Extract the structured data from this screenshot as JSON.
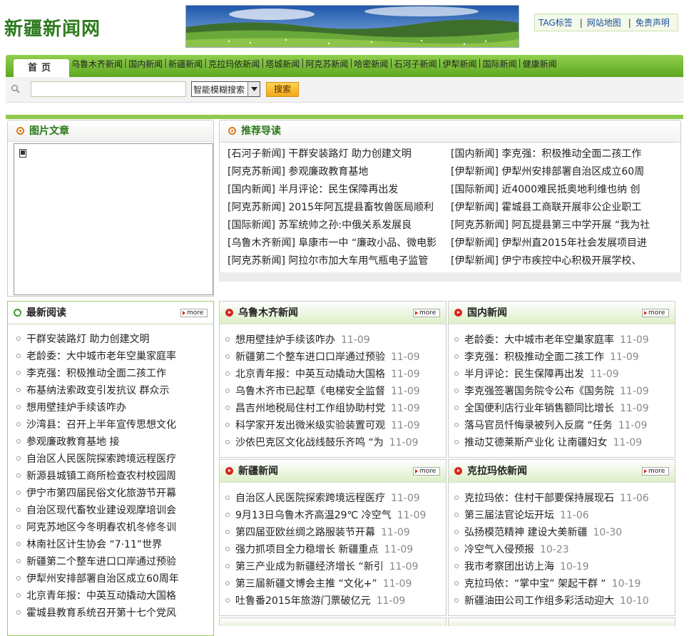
{
  "logo": {
    "text": "新疆新闻网"
  },
  "top_links": [
    {
      "label": "TAG标签"
    },
    {
      "label": "网站地图"
    },
    {
      "label": "免责声明"
    }
  ],
  "nav": {
    "home": "首页",
    "items": [
      "乌鲁木齐新闻",
      "国内新闻",
      "新疆新闻",
      "克拉玛依新闻",
      "塔城新闻",
      "阿克苏新闻",
      "哈密新闻",
      "石河子新闻",
      "伊犁新闻",
      "国际新闻",
      "健康新闻"
    ]
  },
  "search": {
    "input_value": "",
    "select_value": "智能模糊搜索",
    "button_label": "搜索"
  },
  "picture_articles": {
    "title": "图片文章"
  },
  "recommend": {
    "title": "推荐导读",
    "left": [
      "[石河子新闻] 干群安装路灯 助力创建文明",
      "[阿克苏新闻] 参观廉政教育基地",
      "[国内新闻] 半月评论：民生保障再出发",
      "[阿克苏新闻] 2015年阿瓦提县畜牧兽医局顺利",
      "[国际新闻] 苏军统帅之孙:中俄关系发展良",
      "[乌鲁木齐新闻] 阜康市一中 “廉政小品、微电影",
      "[阿克苏新闻] 阿拉尔市加大车用气瓶电子监管"
    ],
    "right": [
      "[国内新闻] 李克强：积极推动全面二孩工作",
      "[伊犁新闻] 伊犁州安排部署自治区成立60周",
      "[国际新闻] 近4000难民抵奥地利维也纳 创",
      "[伊犁新闻] 霍城县工商联开展非公企业职工",
      "[阿克苏新闻] 阿瓦提县第三中学开展 “我为社",
      "[伊犁新闻] 伊犁州直2015年社会发展项目进",
      "[伊犁新闻] 伊宁市疾控中心积极开展学校、"
    ]
  },
  "latest": {
    "title": "最新阅读",
    "more": "more",
    "items": [
      "干群安装路灯 助力创建文明",
      "老龄委：大中城市老年空巢家庭率",
      "李克强：积极推动全面二孩工作",
      "布基纳法索政变引发抗议 群众示",
      "想用壁挂炉手续该咋办",
      "沙湾县：召开上半年宣传思想文化",
      "参观廉政教育基地 接",
      "自治区人民医院探索跨境远程医疗",
      "新源县城镇工商所检查农村校园周",
      "伊宁市第四届民俗文化旅游节开幕",
      "自治区现代畜牧业建设观摩培训会",
      "阿克苏地区今冬明春农机冬修冬训",
      "林南社区计生协会 “7·11”世界",
      "新疆第二个整车进口口岸通过预验",
      "伊犁州安排部署自治区成立60周年",
      "北京青年报：中英互动撬动大国格",
      "霍城县教育系统召开第十七个党风"
    ]
  },
  "sections": [
    {
      "title": "乌鲁木齐新闻",
      "more": "more",
      "items": [
        {
          "text": "想用壁挂炉手续该咋办",
          "date": "11-09"
        },
        {
          "text": "新疆第二个整车进口口岸通过预验",
          "date": "11-09"
        },
        {
          "text": "北京青年报：中英互动撬动大国格",
          "date": "11-09"
        },
        {
          "text": "乌鲁木齐市已起草《电梯安全监督",
          "date": "11-09"
        },
        {
          "text": "昌吉州地税局住村工作组协助村党",
          "date": "11-09"
        },
        {
          "text": "科学家开发出微米级实验装置可观",
          "date": "11-09"
        },
        {
          "text": "沙依巴克区文化战线鼓乐齐鸣 “为",
          "date": "11-09"
        }
      ]
    },
    {
      "title": "国内新闻",
      "more": "more",
      "items": [
        {
          "text": "老龄委：大中城市老年空巢家庭率",
          "date": "11-09"
        },
        {
          "text": "李克强：积极推动全面二孩工作",
          "date": "11-09"
        },
        {
          "text": "半月评论：民生保障再出发",
          "date": "11-09"
        },
        {
          "text": "李克强签署国务院令公布《国务院",
          "date": "11-09"
        },
        {
          "text": "全国便利店行业年销售额同比增长",
          "date": "11-09"
        },
        {
          "text": "落马官员忏悔录被列入反腐 “任务",
          "date": "11-09"
        },
        {
          "text": "推动艾德莱斯产业化 让南疆妇女",
          "date": "11-09"
        }
      ]
    },
    {
      "title": "新疆新闻",
      "more": "more",
      "items": [
        {
          "text": "自治区人民医院探索跨境远程医疗",
          "date": "11-09"
        },
        {
          "text": "9月13日乌鲁木齐高温29℃ 冷空气",
          "date": "11-09"
        },
        {
          "text": "第四届亚欧丝绸之路服装节开幕",
          "date": "11-09"
        },
        {
          "text": "强力抓项目全力稳增长 新疆重点",
          "date": "11-09"
        },
        {
          "text": "第三产业成为新疆经济增长 “新引",
          "date": "11-09"
        },
        {
          "text": "第三届新疆文博会主推 “文化+”",
          "date": "11-09"
        },
        {
          "text": "吐鲁番2015年旅游门票破亿元",
          "date": "11-09"
        }
      ]
    },
    {
      "title": "克拉玛依新闻",
      "more": "more",
      "items": [
        {
          "text": "克拉玛依：住村干部要保持展现石",
          "date": "11-06"
        },
        {
          "text": "第三届法官论坛开坛",
          "date": "11-06"
        },
        {
          "text": "弘扬模范精神 建设大美新疆",
          "date": "10-30"
        },
        {
          "text": "冷空气入侵预报",
          "date": "10-23"
        },
        {
          "text": "我市考察团出访上海",
          "date": "10-19"
        },
        {
          "text": "克拉玛依：“掌中宝” 架起干群 “",
          "date": "10-19"
        },
        {
          "text": "新疆油田公司工作组多彩活动迎大",
          "date": "10-10"
        }
      ]
    }
  ]
}
